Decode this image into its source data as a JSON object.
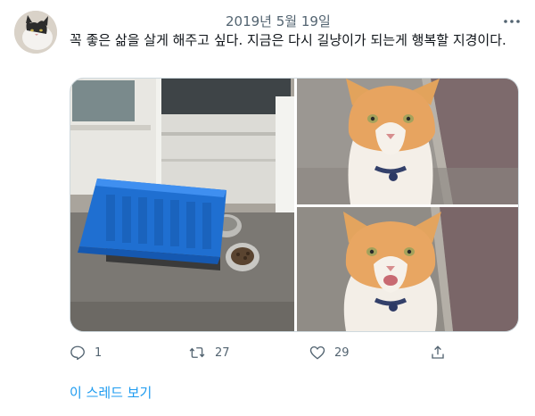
{
  "tweet": {
    "date": "2019년 5월 19일",
    "text": "꼭 좋은 삶을 살게 해주고 싶다. 지금은 다시 길냥이가 되는게 행복할 지경이다.",
    "media": [
      {
        "description": "blue-cat-shelter-with-food-bowls"
      },
      {
        "description": "orange-white-cat-close-up"
      },
      {
        "description": "orange-white-cat-meowing"
      }
    ]
  },
  "actions": {
    "reply": {
      "icon": "reply-icon",
      "count": "1"
    },
    "retweet": {
      "icon": "retweet-icon",
      "count": "27"
    },
    "like": {
      "icon": "heart-icon",
      "count": "29"
    },
    "share": {
      "icon": "share-icon"
    }
  },
  "thread_link": "이 스레드 보기",
  "colors": {
    "link": "#1d9bf0",
    "secondary_text": "#536471",
    "border": "#cfd9de"
  }
}
